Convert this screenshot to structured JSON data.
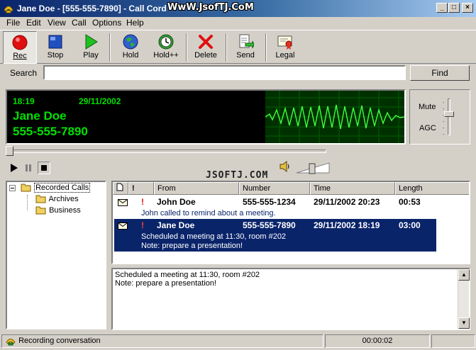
{
  "window": {
    "title": "Jane Doe - [555-555-7890] - Call Cord",
    "watermark": "WwW.JsofTJ.CoM",
    "minimize": "_",
    "maximize": "□",
    "close": "×"
  },
  "menu": [
    "File",
    "Edit",
    "View",
    "Call",
    "Options",
    "Help"
  ],
  "toolbar": {
    "rec": "Rec",
    "stop": "Stop",
    "play": "Play",
    "hold": "Hold",
    "holdpp": "Hold++",
    "delete": "Delete",
    "send": "Send",
    "legal": "Legal"
  },
  "search": {
    "label": "Search",
    "value": "",
    "find": "Find"
  },
  "display": {
    "time": "18:19",
    "date": "29/11/2002",
    "name": "Jane Doe",
    "number": "555-555-7890"
  },
  "controls": {
    "mute": "Mute",
    "agc": "AGC"
  },
  "brand": "JSOFTJ.COM",
  "tree": {
    "root": "Recorded Calls",
    "children": [
      "Archives",
      "Business"
    ]
  },
  "list": {
    "columns": [
      "",
      "!",
      "From",
      "Number",
      "Time",
      "Length"
    ],
    "rows": [
      {
        "flag": "!",
        "from": "John Doe",
        "number": "555-555-1234",
        "time": "29/11/2002 20:23",
        "length": "00:53",
        "note1": "John called to remind about a meeting.",
        "note2": ""
      },
      {
        "flag": "!",
        "from": "Jane Doe",
        "number": "555-555-7890",
        "time": "29/11/2002 18:19",
        "length": "03:00",
        "note1": "Scheduled a meeting at 11:30, room #202",
        "note2": "Note: prepare a presentation!"
      }
    ]
  },
  "memo": {
    "line1": "Scheduled a meeting at 11:30, room #202",
    "line2": "Note: prepare a presentation!"
  },
  "status": {
    "text": "Recording conversation",
    "elapsed": "00:00:02"
  },
  "colors": {
    "accent": "#0a246a",
    "display_text": "#00e000"
  }
}
